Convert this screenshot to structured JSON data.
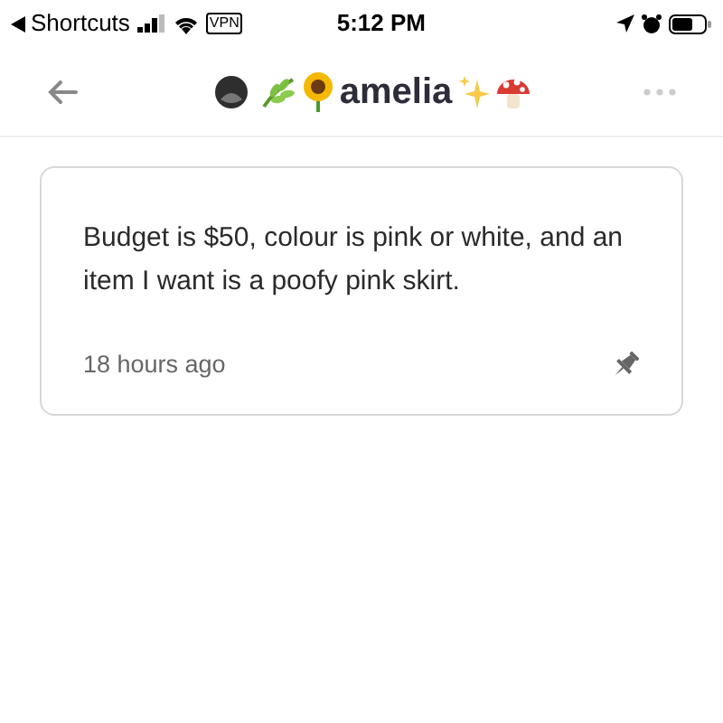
{
  "status_bar": {
    "back_app": "Shortcuts",
    "vpn": "VPN",
    "time": "5:12 PM"
  },
  "nav": {
    "title": "amelia"
  },
  "note": {
    "text": "Budget is $50, colour is pink or white, and an item I want is a poofy pink skirt.",
    "time": "18 hours ago",
    "pinned": true
  }
}
